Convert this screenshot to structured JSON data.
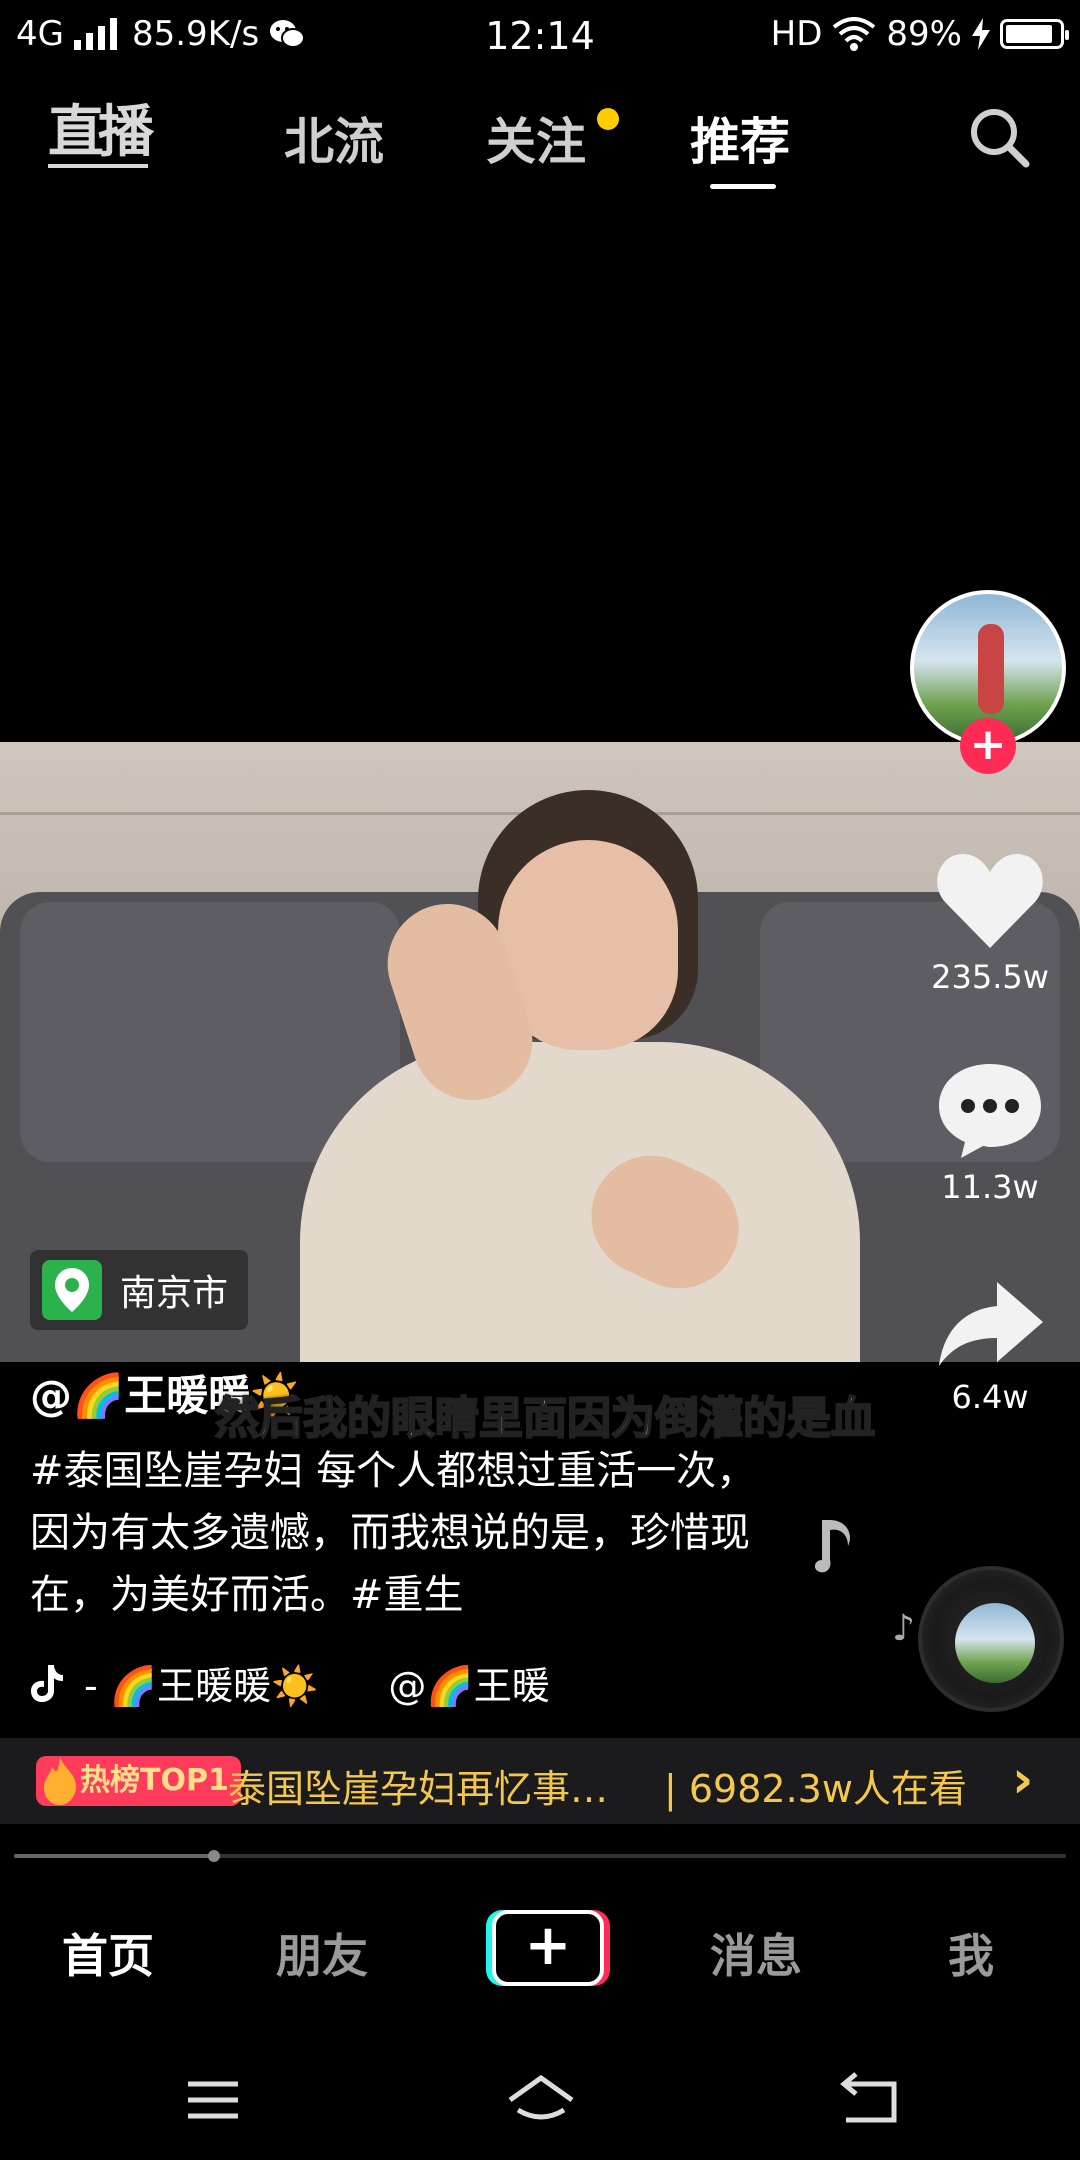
{
  "status_bar": {
    "network": "4G",
    "speed": "85.9K/s",
    "time": "12:14",
    "hd": "HD",
    "battery": "89%"
  },
  "top_tabs": {
    "live_label": "直播",
    "tabs": [
      {
        "label": "北流"
      },
      {
        "label": "关注"
      },
      {
        "label": "推荐"
      }
    ],
    "active_tab": "推荐"
  },
  "video": {
    "location": "南京市",
    "subtitle": "然后我的眼睛里面因为倒灌的是血"
  },
  "actions": {
    "likes": "235.5w",
    "comments": "11.3w",
    "shares": "6.4w"
  },
  "caption": {
    "username": "@🌈王暖暖☀️",
    "description": "#泰国坠崖孕妇 每个人都想过重活一次，因为有太多遗憾，而我想说的是，珍惜现在，为美好而活。#重生",
    "music_author": "- 🌈王暖暖☀️",
    "music_mention": "@🌈王暖"
  },
  "hot_bar": {
    "badge": "热榜TOP1",
    "title": "泰国坠崖孕妇再忆事…",
    "viewers": "| 6982.3w人在看"
  },
  "progress": {
    "fraction": 0.19
  },
  "bottom_nav": {
    "home": "首页",
    "friends": "朋友",
    "create": "+",
    "messages": "消息",
    "me": "我"
  },
  "colors": {
    "accent_red": "#fe2c55",
    "accent_cyan": "#25f4ee",
    "hot_gold": "#f5c84c",
    "notify_dot": "#ffcc00"
  }
}
